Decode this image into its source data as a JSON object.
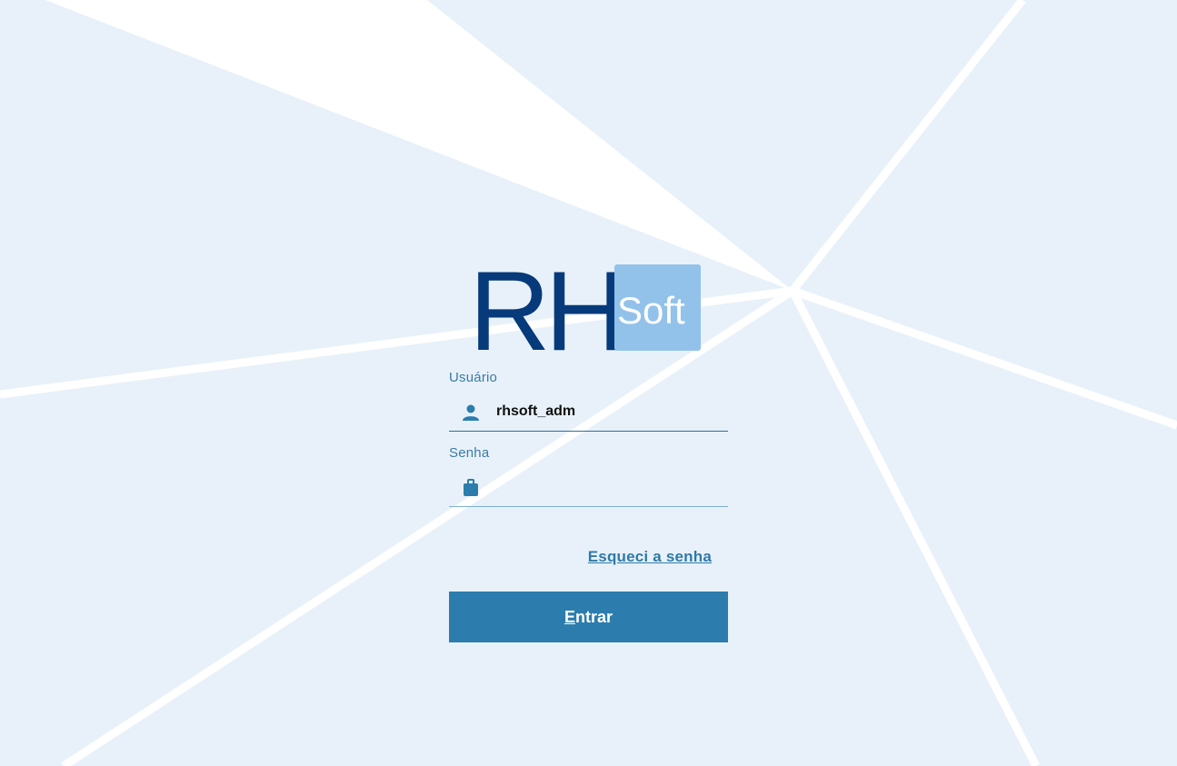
{
  "brand": {
    "logo_text_main": "RH",
    "logo_text_sub": "Soft"
  },
  "login": {
    "user_label": "Usuário",
    "user_value": "rhsoft_adm",
    "password_label": "Senha",
    "password_value": "",
    "forgot_link": "Esqueci a senha",
    "submit_access_key": "E",
    "submit_rest": "ntrar"
  },
  "icons": {
    "user": "user-icon",
    "password": "lock-icon"
  },
  "colors": {
    "background": "#e8f1f9",
    "logo_dark": "#063a7a",
    "logo_light_box": "#92c2ea",
    "accent": "#2c7dad",
    "label": "#3a7ba5"
  }
}
